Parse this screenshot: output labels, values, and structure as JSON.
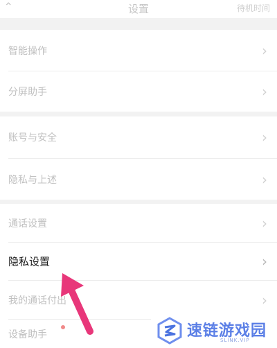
{
  "header": {
    "title": "设置",
    "right_text": "待机时间"
  },
  "settings": {
    "group1": [
      "智能操作",
      "分屏助手"
    ],
    "group2": [
      "账号与安全",
      "隐私与上述"
    ],
    "group3": [
      "通话设置",
      "隐私设置",
      "我的通话付出",
      "设备助手"
    ],
    "active_item": "隐私设置"
  },
  "watermark": {
    "name": "速链游戏园",
    "site": "SLINK.VIP"
  },
  "colors": {
    "arrow": "#e8377a",
    "watermark": "#5b7fe6"
  }
}
